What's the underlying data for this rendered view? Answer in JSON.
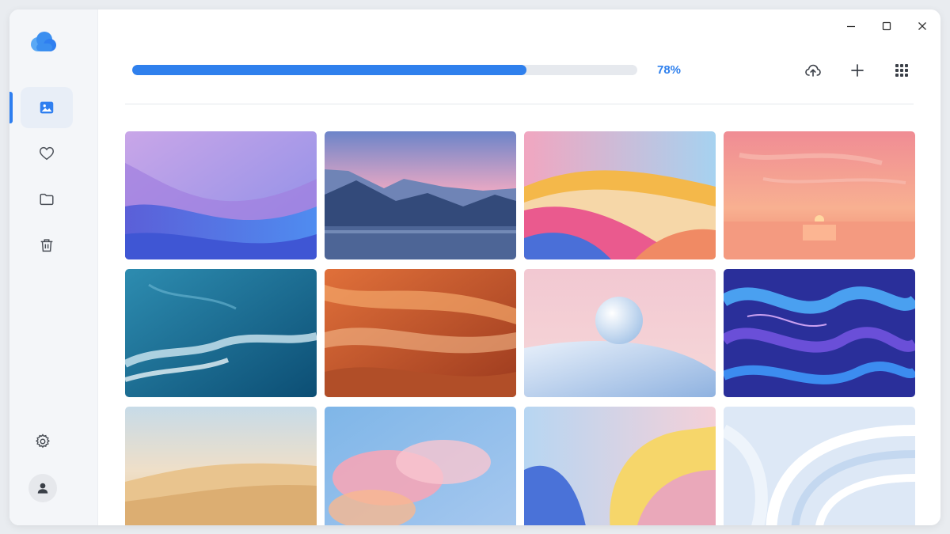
{
  "window": {
    "controls": [
      "minimize",
      "maximize",
      "close"
    ]
  },
  "sidebar": {
    "logo": "cloud-icon",
    "items": [
      {
        "id": "photos",
        "icon": "image-icon",
        "active": true
      },
      {
        "id": "favorites",
        "icon": "heart-icon",
        "active": false
      },
      {
        "id": "folders",
        "icon": "folder-icon",
        "active": false
      },
      {
        "id": "trash",
        "icon": "trash-icon",
        "active": false
      }
    ],
    "settings_icon": "gear-icon",
    "avatar_icon": "user-icon"
  },
  "upload": {
    "progress": 78,
    "progress_label": "78%"
  },
  "toolbar": {
    "buttons": [
      "cloud-upload-icon",
      "plus-icon",
      "grid-icon"
    ]
  },
  "colors": {
    "accent": "#2f80ed",
    "sidebar_bg": "#f4f6f9",
    "track": "#e6e9ee"
  },
  "gallery": {
    "columns": 4,
    "items": [
      {
        "id": "purple-waves"
      },
      {
        "id": "mountain-lake"
      },
      {
        "id": "colorful-waves"
      },
      {
        "id": "sunset-sea"
      },
      {
        "id": "ocean-aerial"
      },
      {
        "id": "sandstone-canyon"
      },
      {
        "id": "pastel-sphere"
      },
      {
        "id": "blue-swirl"
      },
      {
        "id": "desert-dunes"
      },
      {
        "id": "pink-clouds"
      },
      {
        "id": "pastel-curves"
      },
      {
        "id": "white-spiral"
      }
    ]
  }
}
